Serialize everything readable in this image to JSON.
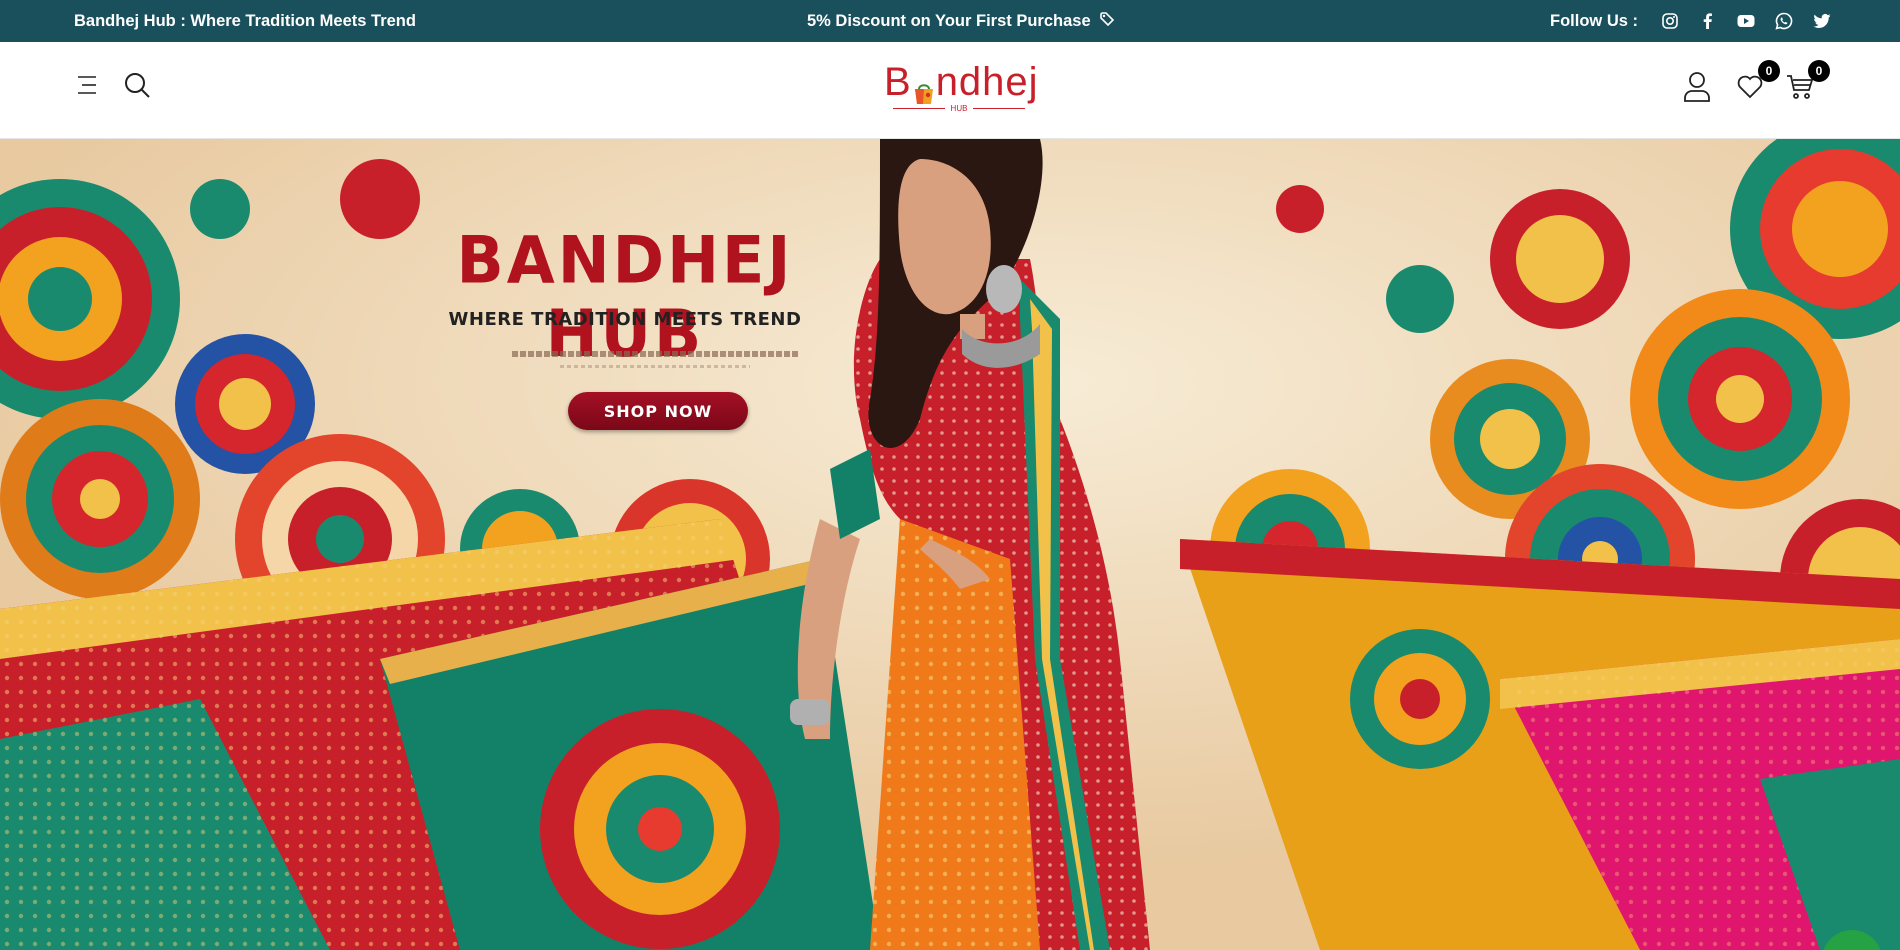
{
  "topbar": {
    "tagline": "Bandhej Hub : Where Tradition Meets Trend",
    "promo": "5% Discount on Your First Purchase",
    "follow_label": "Follow Us :",
    "social": [
      "instagram-icon",
      "facebook-icon",
      "youtube-icon",
      "whatsapp-icon",
      "twitter-icon"
    ],
    "background": "#1a4f5c"
  },
  "header": {
    "logo_word": "B  ndhej",
    "logo_word_parts": [
      "B",
      "ndhej"
    ],
    "logo_sub": "HUB",
    "wishlist_count": "0",
    "cart_count": "0",
    "icons": [
      "menu-icon",
      "search-icon",
      "user-icon",
      "heart-icon",
      "cart-icon"
    ]
  },
  "hero": {
    "title": "BANDHEJ HUB",
    "subtitle": "WHERE TRADITION MEETS TREND",
    "cta_label": "SHOP NOW",
    "accent": "#b0121e"
  }
}
